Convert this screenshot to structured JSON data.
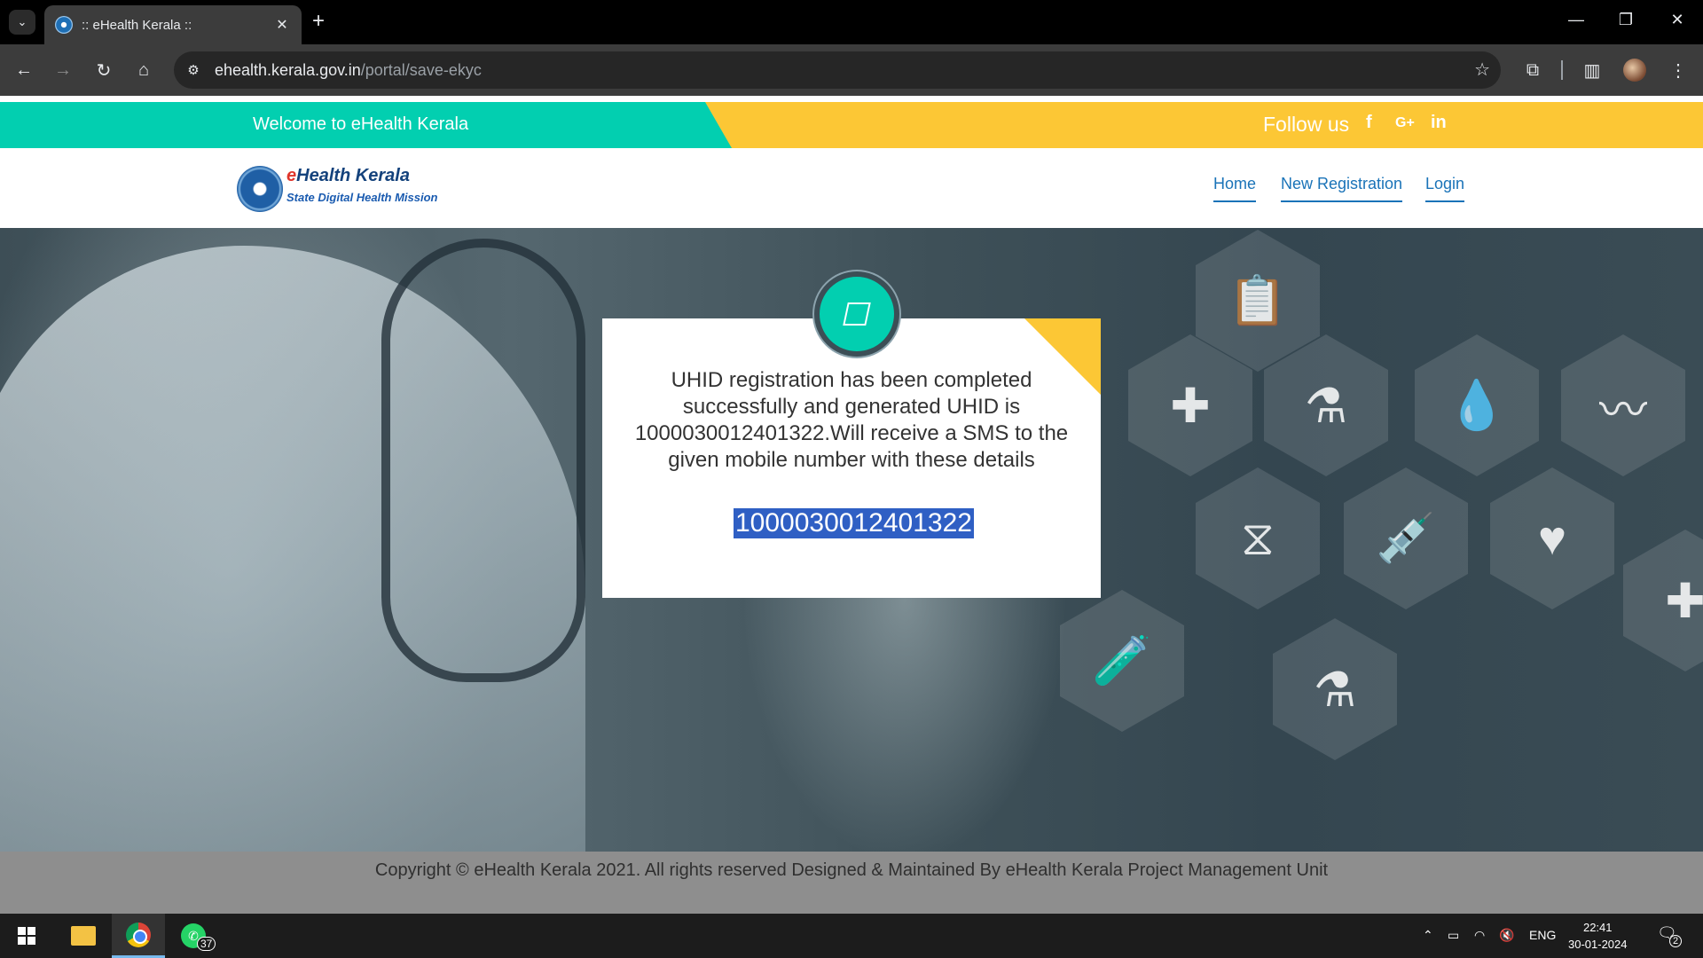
{
  "browser": {
    "tab_title": ":: eHealth Kerala ::",
    "url_host": "ehealth.kerala.gov.in",
    "url_path": "/portal/save-ekyc"
  },
  "topbar": {
    "welcome": "Welcome to eHealth Kerala",
    "follow": "Follow us",
    "social": [
      "f",
      "G+",
      "in"
    ]
  },
  "logo": {
    "title_e": "e",
    "title_rest": "Health Kerala",
    "subtitle": "State Digital Health Mission"
  },
  "nav": {
    "home": "Home",
    "new_registration": "New Registration",
    "login": "Login"
  },
  "modal": {
    "message": "UHID registration has been completed successfully and generated UHID is 1000030012401322.Will receive a SMS to the given mobile number with these details",
    "uhid": "1000030012401322"
  },
  "footer": {
    "copyright": "Copyright © eHealth Kerala 2021. All rights reserved Designed & Maintained By eHealth Kerala Project Management Unit"
  },
  "taskbar": {
    "whatsapp_badge": "37",
    "language": "ENG",
    "time": "22:41",
    "date": "30-01-2024",
    "notification_count": "2"
  },
  "colors": {
    "teal": "#02cfb0",
    "yellow": "#fcc735",
    "link": "#1a73b8"
  }
}
